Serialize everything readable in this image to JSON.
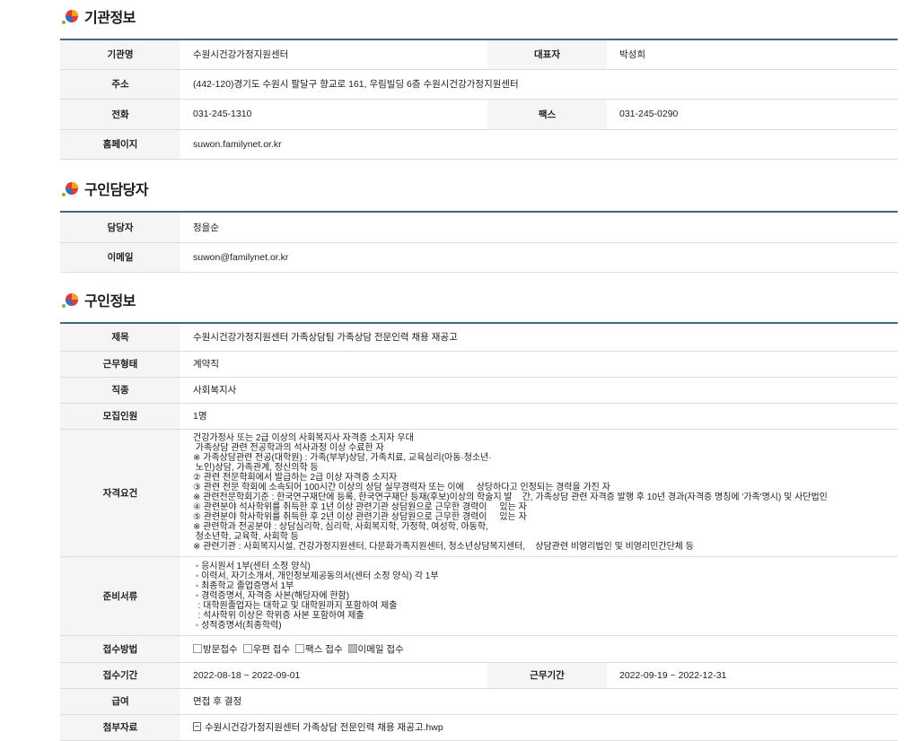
{
  "sections": {
    "org": {
      "title": "기관정보"
    },
    "contact": {
      "title": "구인담당자"
    },
    "job": {
      "title": "구인정보"
    }
  },
  "org": {
    "name_label": "기관명",
    "name": "수원시건강가정지원센터",
    "rep_label": "대표자",
    "rep": "박성희",
    "addr_label": "주소",
    "addr": "(442-120)경기도 수원시 팔달구 향교로 161, 우림빌딩 6층 수원시건강가정지원센터",
    "phone_label": "전화",
    "phone": "031-245-1310",
    "fax_label": "팩스",
    "fax": "031-245-0290",
    "web_label": "홈페이지",
    "web": "suwon.familynet.or.kr"
  },
  "contact": {
    "person_label": "담당자",
    "person": "정을순",
    "email_label": "이메일",
    "email": "suwon@familynet.or.kr"
  },
  "job": {
    "title_label": "제목",
    "title": "수원시건강가정지원센터 가족상담팀 가족상담 전문인력 채용 재공고",
    "type_label": "근무형태",
    "type": "계약직",
    "occupation_label": "직종",
    "occupation": "사회복지사",
    "headcount_label": "모집인원",
    "headcount": "1명",
    "qual_label": "자격요건",
    "qual": "건강가정사 또는 2급 이상의 사회복지사 자격증 소지자 우대\n 가족상담 관련 전공학과의 석사과정 이상 수료한 자\n※ 가족상담관련 전공(대학원) : 가족(부부)상담, 가족치료, 교육심리(아동·청소년·\n 노인)상담, 가족관계, 정신의학 등\n② 관련 전문학회에서 발급하는 2급 이상 자격증 소지자\n③ 관련 전문 학회에 소속되어 100시간 이상의 상담 실무경력자 또는 이에     상당하다고 인정되는 경력을 가진 자\n※ 관련전문학회기준 : 한국연구재단에 등록, 한국연구재단 등재(후보)이상의 학술지 발    간, 가족상담 관련 자격증 발행 후 10년 경과(자격증 명칭에 '가족'명시) 및 사단법인\n④ 관련분야 석사학위를 취득한 후 1년 이상 관련기관 상담원으로 근무한 경력이     있는 자\n⑤ 관련분야 학사학위를 취득한 후 2년 이상 관련기관 상담원으로 근무한 경력이     있는 자\n※ 관련학과 전공분야 : 상담심리학, 심리학, 사회복지학, 가정학, 여성학, 아동학,\n 청소년학, 교육학, 사회학 등\n※ 관련기관 : 사회복지시설, 건강가정지원센터, 다문화가족지원센터, 청소년상담복지센터,    상담관련 비영리법인 및 비영리민간단체 등",
    "docs_label": "준비서류",
    "docs": " ◦ 응시원서 1부(센터 소정 양식)\n ◦ 이력서, 자기소개서, 개인정보제공동의서(센터 소정 양식) 각 1부\n ◦ 최종학교 졸업증명서 1부\n ◦ 경력증명서, 자격증 사본(해당자에 한함)\n  : 대학원졸업자는 대학교 및 대학원까지 포함하여 제출\n  : 석사학위 이상은 학위증 사본 포함하여 제출\n ◦ 성적증명서(최종학력)",
    "method_label": "접수방법",
    "methods": [
      {
        "label": "방문접수",
        "checked": false
      },
      {
        "label": "우편 접수",
        "checked": false
      },
      {
        "label": "팩스 접수",
        "checked": false
      },
      {
        "label": "이메일 접수",
        "checked": true
      }
    ],
    "period_label": "접수기간",
    "period": "2022-08-18 ~ 2022-09-01",
    "work_period_label": "근무기간",
    "work_period": "2022-09-19 ~ 2022-12-31",
    "salary_label": "급여",
    "salary": "면접 후 결정",
    "attach_label": "첨부자료",
    "attach": "수원시건강가정지원센터 가족상담 전문인력 채용 재공고.hwp"
  }
}
